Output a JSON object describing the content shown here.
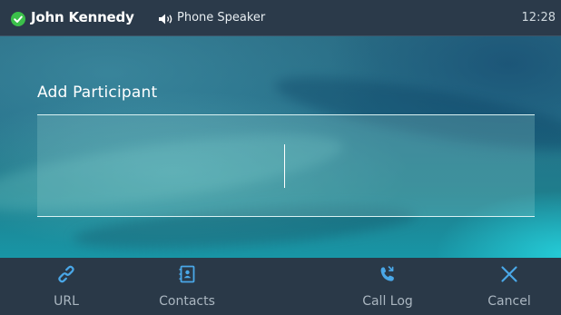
{
  "status_bar": {
    "user_name": "John Kennedy",
    "audio_mode": "Phone Speaker",
    "time": "12:28",
    "presence_icon": "available-check-icon",
    "speaker_icon": "speaker-icon",
    "presence_color": "#3bbf4a"
  },
  "dialog": {
    "title": "Add Participant",
    "input_value": ""
  },
  "softkeys": [
    {
      "label": "URL",
      "icon": "link-icon"
    },
    {
      "label": "Contacts",
      "icon": "contacts-book-icon"
    },
    {
      "label": "Call Log",
      "icon": "call-log-icon"
    },
    {
      "label": "Cancel",
      "icon": "close-icon"
    }
  ],
  "colors": {
    "accent_icon": "#4aa8e8",
    "statusbar_bg": "#2b3a4a",
    "softkey_bg": "#2a3948"
  }
}
